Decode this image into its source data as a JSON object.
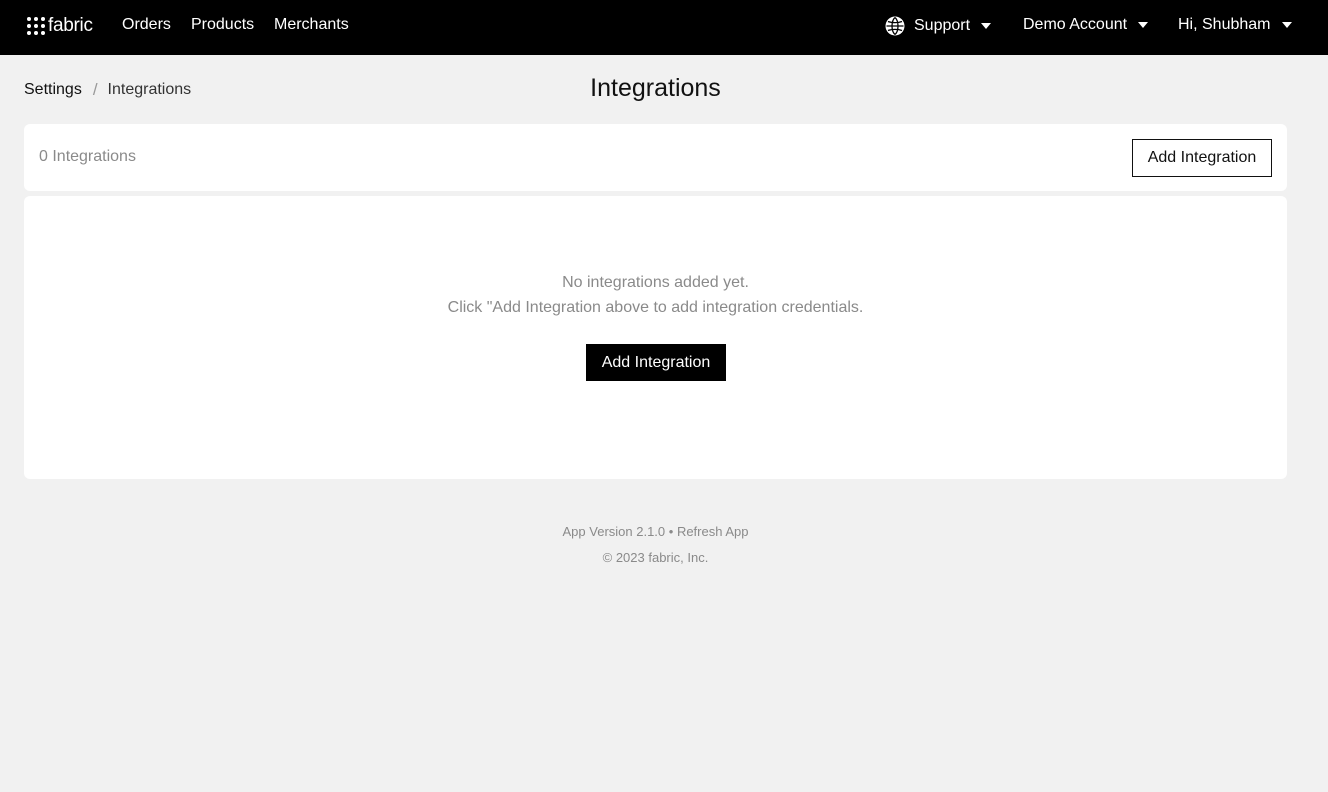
{
  "header": {
    "logo_text": "fabric",
    "nav": {
      "orders": "Orders",
      "products": "Products",
      "merchants": "Merchants"
    },
    "support_label": "Support",
    "account_label": "Demo Account",
    "user_label": "Hi, Shubham"
  },
  "breadcrumb": {
    "parent": "Settings",
    "separator": "/",
    "current": "Integrations"
  },
  "page": {
    "title": "Integrations"
  },
  "summary": {
    "count_text": "0 Integrations",
    "add_button_label": "Add Integration"
  },
  "empty_state": {
    "line1": "No integrations added yet.",
    "line2": "Click \"Add Integration above to add integration credentials.",
    "add_button_label": "Add Integration"
  },
  "footer": {
    "version_text": "App Version 2.1.0",
    "separator": " • ",
    "refresh_label": "Refresh App",
    "copyright": "© 2023 fabric, Inc."
  },
  "colors": {
    "topbar_bg": "#000000",
    "page_bg": "#f1f1f1",
    "card_bg": "#ffffff",
    "muted_text": "#8a8a8a"
  }
}
